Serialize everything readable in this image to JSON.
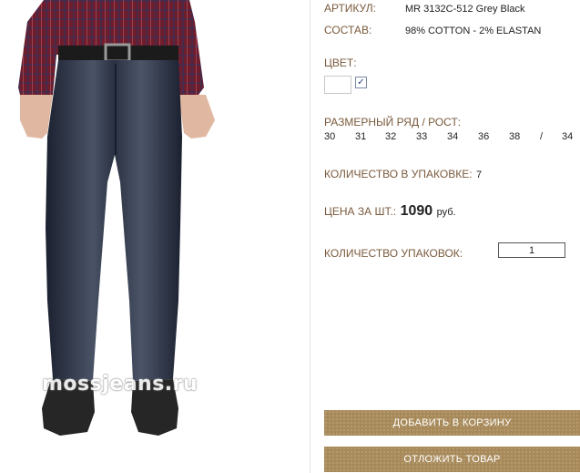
{
  "product": {
    "article_label": "АРТИКУЛ:",
    "article_value": "MR 3132C-512 Grey Black",
    "composition_label": "СОСТАВ:",
    "composition_value": "98% COTTON - 2% ELASTAN",
    "color_label": "ЦВЕТ:",
    "color_checked": "✓",
    "sizes_label": "РАЗМЕРНЫЙ РЯД / РОСТ:",
    "sizes": [
      "30",
      "31",
      "32",
      "33",
      "34",
      "36",
      "38",
      "/",
      "34"
    ],
    "pack_label": "КОЛИЧЕСТВО В УПАКОВКЕ:",
    "pack_value": "7",
    "price_label": "ЦЕНА ЗА ШТ.:",
    "price_value": "1090",
    "price_currency": "руб.",
    "qty_label": "КОЛИЧЕСТВО УПАКОВОК:",
    "qty_value": "1"
  },
  "buttons": {
    "add_to_cart": "ДОБАВИТЬ В КОРЗИНУ",
    "defer": "ОТЛОЖИТЬ ТОВАР"
  },
  "watermark": "mossjeans.ru",
  "colors": {
    "label_brown": "#7a5a3c",
    "button_brown": "#a88a5a"
  }
}
